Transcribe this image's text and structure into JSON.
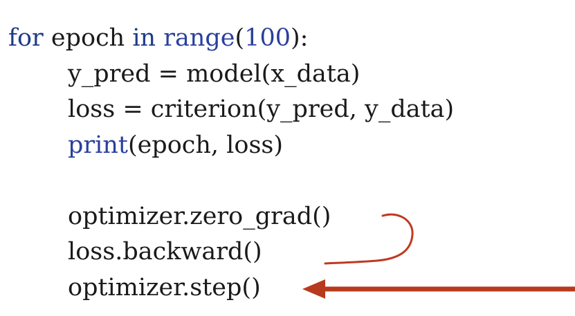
{
  "code": {
    "line1": {
      "kw_for": "for",
      "var_epoch": " epoch ",
      "kw_in": "in",
      "sp": " ",
      "fn_range": "range",
      "paren_open": "(",
      "num": "100",
      "paren_close_colon": "):"
    },
    "line2": {
      "text": "y_pred = model(x_data)"
    },
    "line3": {
      "text": "loss = criterion(y_pred, y_data)"
    },
    "line4": {
      "fn_print": "print",
      "args": "(epoch, loss)"
    },
    "line5": {
      "text": "optimizer.zero_grad()"
    },
    "line6": {
      "text": "loss.backward()"
    },
    "line7": {
      "text": "optimizer.step()"
    }
  },
  "colors": {
    "keyword": "#1f3a8a",
    "builtin": "#2a3f9e",
    "text": "#1a1a1a",
    "annotation_red": "#c0391f",
    "big_arrow_red": "#b83a1e"
  },
  "icons": {
    "curve": "curved-bracket-annotation-icon",
    "arrow": "left-arrow-annotation-icon"
  }
}
